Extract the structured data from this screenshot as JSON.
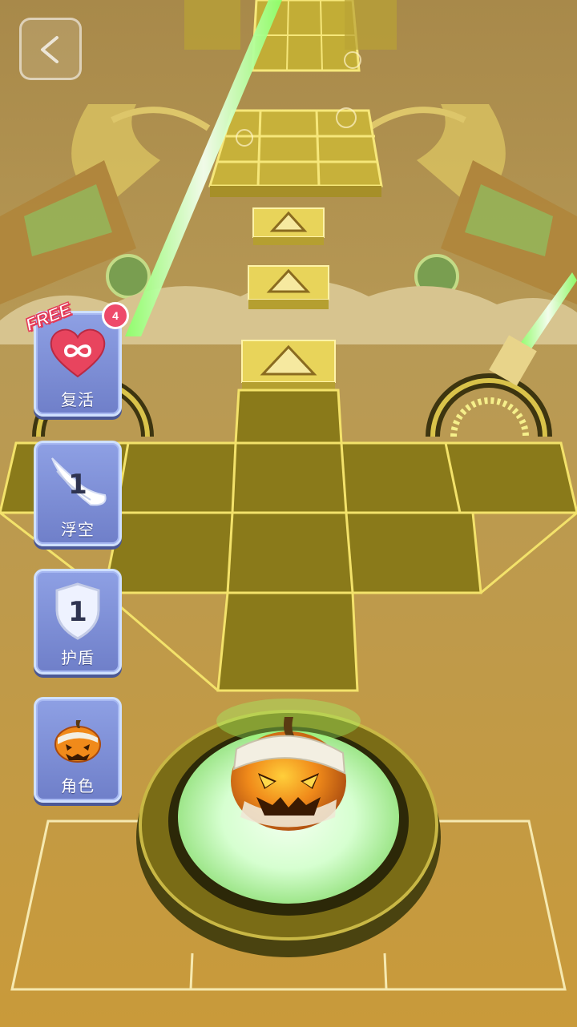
{
  "hud": {
    "back_button_icon": "back-arrow-icon"
  },
  "powerups": {
    "revive": {
      "label": "复活",
      "free_tag": "FREE",
      "badge_count": "4",
      "icon": "heart-infinity-icon"
    },
    "float": {
      "label": "浮空",
      "count": "1",
      "icon": "wing-icon"
    },
    "shield": {
      "label": "护盾",
      "count": "1",
      "icon": "shield-icon"
    },
    "character": {
      "label": "角色",
      "icon": "pumpkin-icon"
    }
  },
  "colors": {
    "tile": "#8a7a1a",
    "tile_line": "#f3e26a",
    "ground": "#c99a3a",
    "card": "#7d8ed8",
    "glow": "#9eff6a",
    "heart": "#e8445e"
  }
}
